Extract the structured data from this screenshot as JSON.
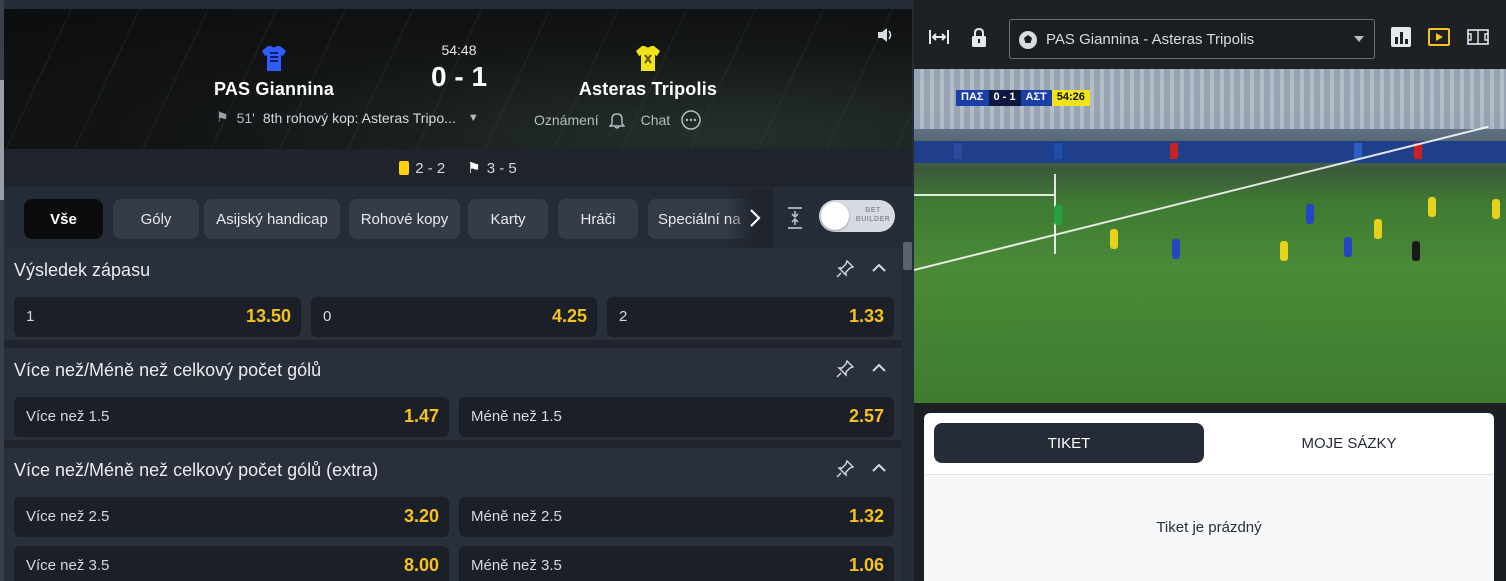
{
  "header": {
    "home_team": "PAS  Giannina",
    "away_team": "Asteras  Tripolis",
    "clock": "54:48",
    "score": "0 - 1",
    "event_minute": "51'",
    "event_text": "8th rohový kop: Asteras Tripo...",
    "notifications_label": "Oznámení",
    "chat_label": "Chat",
    "home_color": "#2e5cff",
    "away_color": "#f2e21a"
  },
  "stats": {
    "cards": "2 - 2",
    "corners": "3 - 5"
  },
  "tabs": [
    {
      "label": "Vše",
      "active": true
    },
    {
      "label": "Góly"
    },
    {
      "label": "Asijský handicap"
    },
    {
      "label": "Rohové kopy"
    },
    {
      "label": "Karty"
    },
    {
      "label": "Hráči"
    },
    {
      "label": "Speciální na"
    }
  ],
  "bet_builder": {
    "label": "BET BUILDER",
    "enabled": false
  },
  "markets": [
    {
      "title": "Výsledek zápasu",
      "rows": [
        [
          {
            "label": "1",
            "odds": "13.50"
          },
          {
            "label": "0",
            "odds": "4.25"
          },
          {
            "label": "2",
            "odds": "1.33"
          }
        ]
      ]
    },
    {
      "title": "Více než/Méně než celkový počet gólů",
      "rows": [
        [
          {
            "label": "Více než 1.5",
            "odds": "1.47"
          },
          {
            "label": "Méně než 1.5",
            "odds": "2.57"
          }
        ]
      ]
    },
    {
      "title": "Více než/Méně než celkový počet gólů (extra)",
      "rows": [
        [
          {
            "label": "Více než 2.5",
            "odds": "3.20"
          },
          {
            "label": "Méně než 2.5",
            "odds": "1.32"
          }
        ],
        [
          {
            "label": "Více než 3.5",
            "odds": "8.00"
          },
          {
            "label": "Méně než 3.5",
            "odds": "1.06"
          }
        ]
      ]
    }
  ],
  "stream": {
    "match_select": "PAS Giannina - Asteras Tripolis",
    "scorebug": {
      "home": "ΠΑΣ",
      "score": "0 - 1",
      "away": "ΑΣΤ",
      "time": "54:26"
    }
  },
  "ticket": {
    "tab_ticket": "TIKET",
    "tab_my_bets": "MOJE SÁZKY",
    "empty_text": "Tiket je prázdný"
  },
  "colors": {
    "accent_yellow": "#f6c21c",
    "panel": "#262c37",
    "odds_bg": "#1b1f27"
  }
}
